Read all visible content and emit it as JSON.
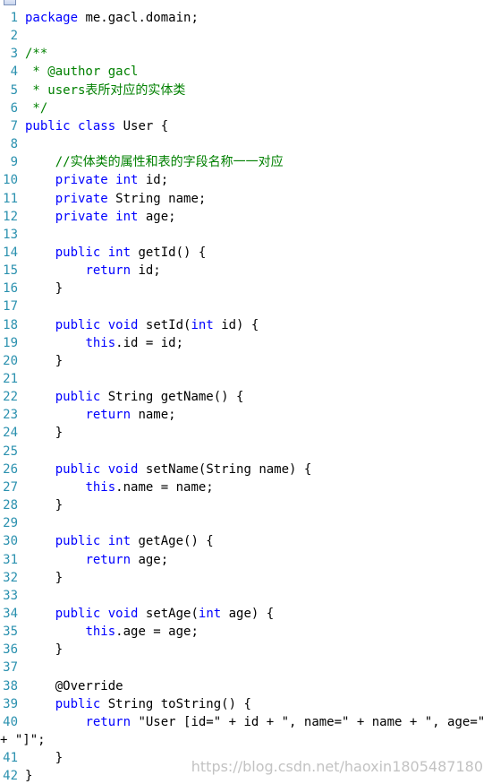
{
  "editor": {
    "icon": "document-icon",
    "colors": {
      "background": "#ffffff",
      "line_number": "#2b91af",
      "keyword": "#0000ff",
      "comment": "#008000",
      "text": "#000000"
    },
    "lines": [
      {
        "n": "1",
        "segments": [
          {
            "t": "package ",
            "c": "kw"
          },
          {
            "t": "me.gacl.domain;",
            "c": ""
          }
        ]
      },
      {
        "n": "2",
        "segments": []
      },
      {
        "n": "3",
        "segments": [
          {
            "t": "/**",
            "c": "cm"
          }
        ]
      },
      {
        "n": "4",
        "segments": [
          {
            "t": " * @author gacl",
            "c": "cm"
          }
        ]
      },
      {
        "n": "5",
        "segments": [
          {
            "t": " * users表所对应的实体类",
            "c": "cm"
          }
        ]
      },
      {
        "n": "6",
        "segments": [
          {
            "t": " */",
            "c": "cm"
          }
        ]
      },
      {
        "n": "7",
        "segments": [
          {
            "t": "public ",
            "c": "kw"
          },
          {
            "t": "class ",
            "c": "kw"
          },
          {
            "t": "User {",
            "c": ""
          }
        ]
      },
      {
        "n": "8",
        "segments": []
      },
      {
        "n": "9",
        "segments": [
          {
            "t": "    ",
            "c": ""
          },
          {
            "t": "//实体类的属性和表的字段名称一一对应",
            "c": "cm"
          }
        ]
      },
      {
        "n": "10",
        "segments": [
          {
            "t": "    ",
            "c": ""
          },
          {
            "t": "private ",
            "c": "kw"
          },
          {
            "t": "int ",
            "c": "kw"
          },
          {
            "t": "id;",
            "c": ""
          }
        ]
      },
      {
        "n": "11",
        "segments": [
          {
            "t": "    ",
            "c": ""
          },
          {
            "t": "private ",
            "c": "kw"
          },
          {
            "t": "String name;",
            "c": ""
          }
        ]
      },
      {
        "n": "12",
        "segments": [
          {
            "t": "    ",
            "c": ""
          },
          {
            "t": "private ",
            "c": "kw"
          },
          {
            "t": "int ",
            "c": "kw"
          },
          {
            "t": "age;",
            "c": ""
          }
        ]
      },
      {
        "n": "13",
        "segments": []
      },
      {
        "n": "14",
        "segments": [
          {
            "t": "    ",
            "c": ""
          },
          {
            "t": "public ",
            "c": "kw"
          },
          {
            "t": "int ",
            "c": "kw"
          },
          {
            "t": "getId() {",
            "c": ""
          }
        ]
      },
      {
        "n": "15",
        "segments": [
          {
            "t": "        ",
            "c": ""
          },
          {
            "t": "return ",
            "c": "kw"
          },
          {
            "t": "id;",
            "c": ""
          }
        ]
      },
      {
        "n": "16",
        "segments": [
          {
            "t": "    }",
            "c": ""
          }
        ]
      },
      {
        "n": "17",
        "segments": []
      },
      {
        "n": "18",
        "segments": [
          {
            "t": "    ",
            "c": ""
          },
          {
            "t": "public ",
            "c": "kw"
          },
          {
            "t": "void ",
            "c": "kw"
          },
          {
            "t": "setId(",
            "c": ""
          },
          {
            "t": "int ",
            "c": "kw"
          },
          {
            "t": "id) {",
            "c": ""
          }
        ]
      },
      {
        "n": "19",
        "segments": [
          {
            "t": "        ",
            "c": ""
          },
          {
            "t": "this",
            "c": "kw"
          },
          {
            "t": ".id = id;",
            "c": ""
          }
        ]
      },
      {
        "n": "20",
        "segments": [
          {
            "t": "    }",
            "c": ""
          }
        ]
      },
      {
        "n": "21",
        "segments": []
      },
      {
        "n": "22",
        "segments": [
          {
            "t": "    ",
            "c": ""
          },
          {
            "t": "public ",
            "c": "kw"
          },
          {
            "t": "String getName() {",
            "c": ""
          }
        ]
      },
      {
        "n": "23",
        "segments": [
          {
            "t": "        ",
            "c": ""
          },
          {
            "t": "return ",
            "c": "kw"
          },
          {
            "t": "name;",
            "c": ""
          }
        ]
      },
      {
        "n": "24",
        "segments": [
          {
            "t": "    }",
            "c": ""
          }
        ]
      },
      {
        "n": "25",
        "segments": []
      },
      {
        "n": "26",
        "segments": [
          {
            "t": "    ",
            "c": ""
          },
          {
            "t": "public ",
            "c": "kw"
          },
          {
            "t": "void ",
            "c": "kw"
          },
          {
            "t": "setName(String name) {",
            "c": ""
          }
        ]
      },
      {
        "n": "27",
        "segments": [
          {
            "t": "        ",
            "c": ""
          },
          {
            "t": "this",
            "c": "kw"
          },
          {
            "t": ".name = name;",
            "c": ""
          }
        ]
      },
      {
        "n": "28",
        "segments": [
          {
            "t": "    }",
            "c": ""
          }
        ]
      },
      {
        "n": "29",
        "segments": []
      },
      {
        "n": "30",
        "segments": [
          {
            "t": "    ",
            "c": ""
          },
          {
            "t": "public ",
            "c": "kw"
          },
          {
            "t": "int ",
            "c": "kw"
          },
          {
            "t": "getAge() {",
            "c": ""
          }
        ]
      },
      {
        "n": "31",
        "segments": [
          {
            "t": "        ",
            "c": ""
          },
          {
            "t": "return ",
            "c": "kw"
          },
          {
            "t": "age;",
            "c": ""
          }
        ]
      },
      {
        "n": "32",
        "segments": [
          {
            "t": "    }",
            "c": ""
          }
        ]
      },
      {
        "n": "33",
        "segments": []
      },
      {
        "n": "34",
        "segments": [
          {
            "t": "    ",
            "c": ""
          },
          {
            "t": "public ",
            "c": "kw"
          },
          {
            "t": "void ",
            "c": "kw"
          },
          {
            "t": "setAge(",
            "c": ""
          },
          {
            "t": "int ",
            "c": "kw"
          },
          {
            "t": "age) {",
            "c": ""
          }
        ]
      },
      {
        "n": "35",
        "segments": [
          {
            "t": "        ",
            "c": ""
          },
          {
            "t": "this",
            "c": "kw"
          },
          {
            "t": ".age = age;",
            "c": ""
          }
        ]
      },
      {
        "n": "36",
        "segments": [
          {
            "t": "    }",
            "c": ""
          }
        ]
      },
      {
        "n": "37",
        "segments": []
      },
      {
        "n": "38",
        "segments": [
          {
            "t": "    @Override",
            "c": ""
          }
        ]
      },
      {
        "n": "39",
        "segments": [
          {
            "t": "    ",
            "c": ""
          },
          {
            "t": "public ",
            "c": "kw"
          },
          {
            "t": "String toString() {",
            "c": ""
          }
        ]
      },
      {
        "n": "40",
        "segments": [
          {
            "t": "        ",
            "c": ""
          },
          {
            "t": "return ",
            "c": "kw"
          },
          {
            "t": "\"User [id=\" + id + \", name=\" + name + \", age=\" + age",
            "c": ""
          }
        ]
      },
      {
        "n": "",
        "segments": [
          {
            "t": "+ \"]\";",
            "c": ""
          }
        ],
        "continuation": true
      },
      {
        "n": "41",
        "segments": [
          {
            "t": "    }",
            "c": ""
          }
        ]
      },
      {
        "n": "42",
        "segments": [
          {
            "t": "}",
            "c": ""
          }
        ]
      }
    ]
  },
  "watermark": {
    "text": "https://blog.csdn.net/haoxin1805487180"
  }
}
